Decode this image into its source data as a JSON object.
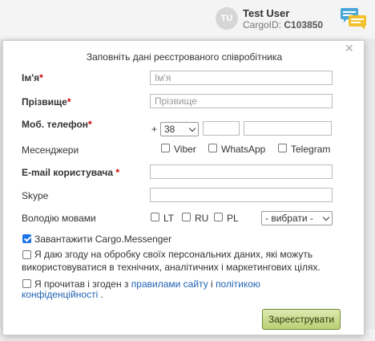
{
  "header": {
    "avatar_initials": "TU",
    "user_name": "Test User",
    "cargo_prefix": "CargoID:",
    "cargo_id": "C103850",
    "chat_icon": "chat-bubbles-icon"
  },
  "modal": {
    "title": "Заповніть дані реєстрованого співробітника",
    "close_icon": "close-icon",
    "fields": {
      "first_name": {
        "label": "Ім'я",
        "placeholder": "Ім'я",
        "value": ""
      },
      "last_name": {
        "label": "Прізвище",
        "placeholder": "Прізвище",
        "value": ""
      },
      "phone": {
        "label": "Моб. телефон",
        "plus": "+",
        "country_code": "38",
        "part1": "",
        "part2": ""
      },
      "messengers": {
        "label": "Месенджери",
        "options": [
          "Viber",
          "WhatsApp",
          "Telegram"
        ]
      },
      "email": {
        "label": "E-mail користувача",
        "value": ""
      },
      "skype": {
        "label": "Skype",
        "value": ""
      },
      "languages": {
        "label": "Володію мовами",
        "options": [
          "LT",
          "RU",
          "PL"
        ],
        "select": "- вибрати -"
      }
    },
    "download_messenger": {
      "label": "Завантажити Cargo.Messenger",
      "checked": true
    },
    "consent_text": "Я даю згоду на обробку своїх персональних даних, які можуть використовуватися в технічних, аналітичних і маркетингових цілях.",
    "consent_line1": "Я даю згоду на обробку своїх персональних даних, які можуть",
    "consent_line2": "використовуватися в технічних, аналітичних і маркетингових цілях.",
    "terms": {
      "prefix": "Я прочитав і згоден з",
      "link1": "правилами сайту",
      "mid": "і",
      "link2": "політикою",
      "link2b": "конфіденційності",
      "suffix": "."
    },
    "submit_label": "Зареєструвати"
  },
  "colors": {
    "accent_link": "#1f62b4",
    "required": "#cc0000",
    "checkbox_on": "#1a73e8",
    "button": "#b9cf73"
  }
}
